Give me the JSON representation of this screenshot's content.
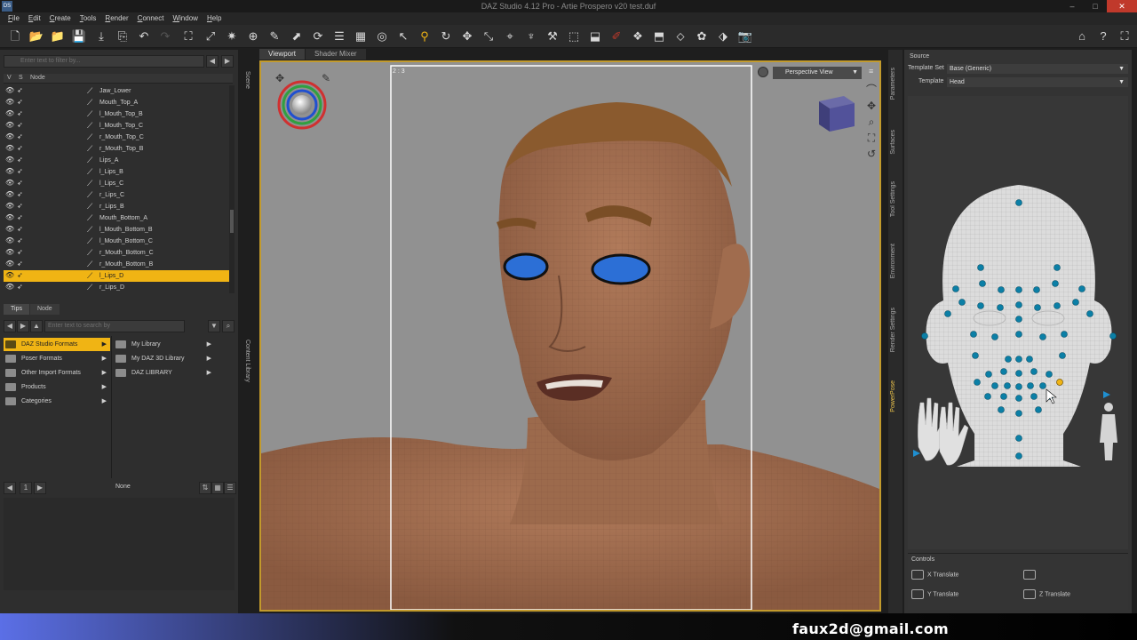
{
  "window": {
    "app_icon": "DS",
    "title": "DAZ Studio 4.12 Pro - Artie Prospero v20 test.duf",
    "controls": [
      "–",
      "□",
      "✕"
    ]
  },
  "menu": [
    "File",
    "Edit",
    "Create",
    "Tools",
    "Render",
    "Connect",
    "Window",
    "Help"
  ],
  "toolbar_icons": [
    "new-icon",
    "open-icon",
    "merge-icon",
    "save-icon",
    "save-as-icon",
    "export-icon",
    "undo-icon",
    "redo-icon",
    "node-select-icon",
    "universal-tool-icon",
    "spot-render-icon",
    "joint-editor-icon",
    "surface-selection-icon",
    "rotate-tool-icon",
    "translate-tool-icon",
    "scale-tool-icon",
    "geometry-editor-icon",
    "powerpose-icon",
    "camera-icon",
    "home-icon",
    "help-icon",
    "layout-icon"
  ],
  "scene": {
    "filter_placeholder": "Enter text to filter by...",
    "headers": {
      "v": "V",
      "s": "S",
      "node": "Node"
    },
    "nodes": [
      "Jaw_Lower",
      "Mouth_Top_A",
      "l_Mouth_Top_B",
      "l_Mouth_Top_C",
      "r_Mouth_Top_C",
      "r_Mouth_Top_B",
      "Lips_A",
      "l_Lips_B",
      "l_Lips_C",
      "r_Lips_C",
      "r_Lips_B",
      "Mouth_Bottom_A",
      "l_Mouth_Bottom_B",
      "l_Mouth_Bottom_C",
      "r_Mouth_Bottom_C",
      "r_Mouth_Bottom_B",
      "l_Lips_D",
      "r_Lips_D"
    ],
    "selected_node": "l_Lips_D",
    "side_tab": "Scene"
  },
  "library": {
    "tabs": [
      "Tips",
      "Node"
    ],
    "filter_placeholder": "Enter text to search by",
    "left_items": [
      "DAZ Studio Formats",
      "Poser Formats",
      "Other Import Formats",
      "Products",
      "Categories"
    ],
    "right_items": [
      "My Library",
      "My DAZ 3D Library",
      "DAZ LIBRARY"
    ],
    "page": "1",
    "status": "None",
    "side_tab": "Content Library"
  },
  "viewport": {
    "tabs": [
      "Viewport",
      "Shader Mixer"
    ],
    "camera": "Perspective View",
    "aspect": "2 : 3"
  },
  "right_tabs": [
    "Parameters",
    "Surfaces",
    "Tool Settings",
    "Environment",
    "Render Settings",
    "PowerPose"
  ],
  "powerpose": {
    "source_label": "Source",
    "template_set_label": "Template Set",
    "template_set": "Base (Generic)",
    "template_label": "Template",
    "template": "Head",
    "controls_label": "Controls",
    "controls": [
      "X Translate",
      "Y Translate",
      "Z Translate"
    ]
  },
  "watermark": "faux2d@gmail.com",
  "colors": {
    "accent": "#f0b414",
    "viewport_bg": "#919191",
    "viewport_border": "#c29a2c",
    "pp_dot": "#0b7fa6"
  }
}
